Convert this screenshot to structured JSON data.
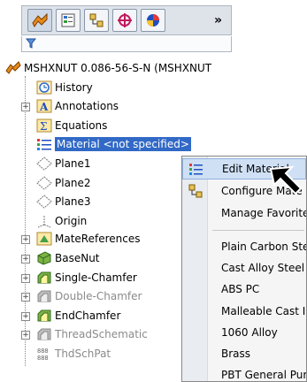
{
  "toolbar": {
    "chevron": "»",
    "buttons": [
      {
        "icon": "feature-manager-icon"
      },
      {
        "icon": "property-manager-icon"
      },
      {
        "icon": "configuration-manager-icon"
      },
      {
        "icon": "dimxpert-icon"
      },
      {
        "icon": "display-manager-icon"
      }
    ]
  },
  "filter": {
    "icon": "filter-icon"
  },
  "tree": {
    "root": "MSHXNUT 0.086-56-S-N  (MSHXNUT",
    "items": [
      {
        "label": "History",
        "icon": "history-icon"
      },
      {
        "label": "Annotations",
        "icon": "annotations-icon"
      },
      {
        "label": "Equations",
        "icon": "equations-icon"
      },
      {
        "label": "Material <not specified>",
        "icon": "material-icon"
      },
      {
        "label": "Plane1",
        "icon": "plane-icon"
      },
      {
        "label": "Plane2",
        "icon": "plane-icon"
      },
      {
        "label": "Plane3",
        "icon": "plane-icon"
      },
      {
        "label": "Origin",
        "icon": "origin-icon"
      },
      {
        "label": "MateReferences",
        "icon": "mate-references-icon"
      },
      {
        "label": "BaseNut",
        "icon": "base-feature-icon"
      },
      {
        "label": "Single-Chamfer",
        "icon": "chamfer-icon"
      },
      {
        "label": "Double-Chamfer",
        "icon": "chamfer-icon"
      },
      {
        "label": "EndChamfer",
        "icon": "chamfer-icon"
      },
      {
        "label": "ThreadSchematic",
        "icon": "chamfer-icon"
      },
      {
        "label": "ThdSchPat",
        "icon": "pattern-icon"
      }
    ]
  },
  "menu": {
    "items": [
      {
        "label": "Edit Material",
        "icon": "material-icon"
      },
      {
        "label": "Configure Mate",
        "icon": "configure-icon"
      },
      {
        "label": "Manage Favorites",
        "icon": ""
      },
      {
        "label": "Plain Carbon Steel"
      },
      {
        "label": "Cast Alloy Steel"
      },
      {
        "label": "ABS PC"
      },
      {
        "label": "Malleable Cast Iron"
      },
      {
        "label": "1060 Alloy"
      },
      {
        "label": "Brass"
      },
      {
        "label": "PBT General Purpose"
      }
    ]
  },
  "colors": {
    "selection": "#3169c6",
    "menu_highlight": "#cfe0f5"
  }
}
